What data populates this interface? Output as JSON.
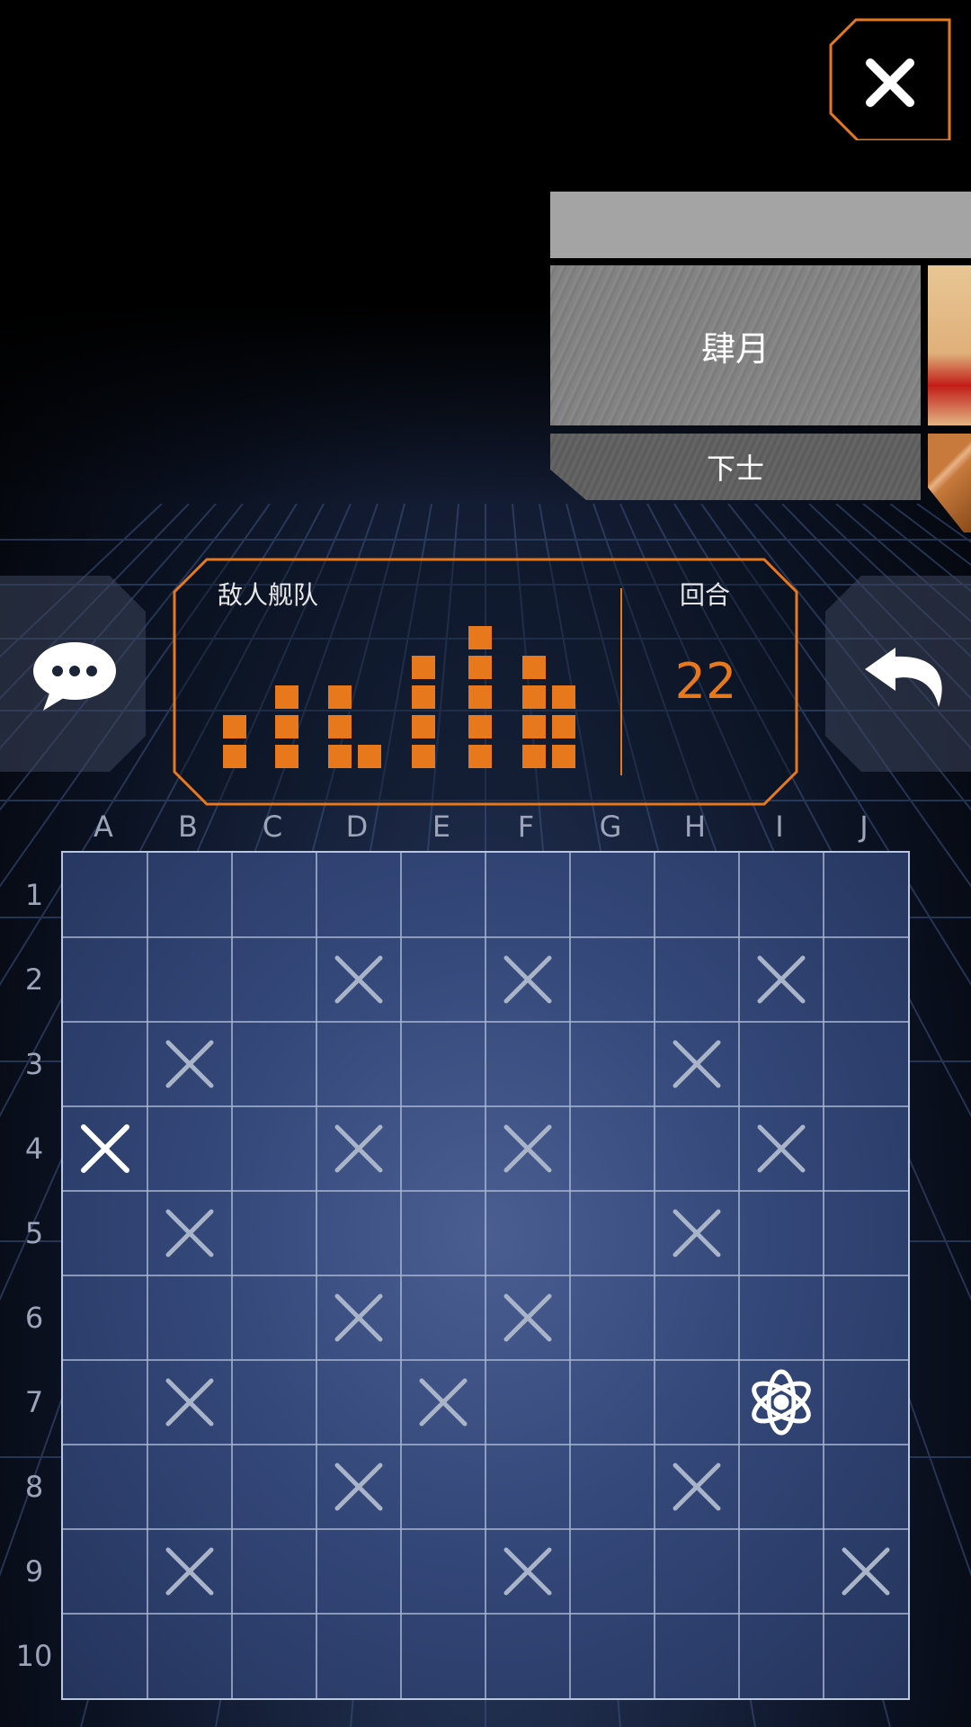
{
  "window": {
    "close_icon": "close-x-icon"
  },
  "opponent": {
    "name": "肆月",
    "rank": "下士"
  },
  "fleet_panel": {
    "title": "敌人舰队",
    "round_label": "回合",
    "round_value": "22",
    "accent_color": "#e8781c",
    "ships": [
      {
        "columns": [
          2
        ]
      },
      {
        "columns": [
          3
        ]
      },
      {
        "columns": [
          3,
          1
        ]
      },
      {
        "columns": [
          4
        ]
      },
      {
        "columns": [
          5
        ]
      },
      {
        "columns": [
          4,
          3
        ]
      }
    ]
  },
  "actions": {
    "chat_icon": "chat-bubble-icon",
    "undo_icon": "undo-arrow-icon"
  },
  "board": {
    "columns": [
      "A",
      "B",
      "C",
      "D",
      "E",
      "F",
      "G",
      "H",
      "I",
      "J"
    ],
    "rows": [
      "1",
      "2",
      "3",
      "4",
      "5",
      "6",
      "7",
      "8",
      "9",
      "10"
    ],
    "misses": [
      [
        3,
        1
      ],
      [
        5,
        1
      ],
      [
        8,
        1
      ],
      [
        1,
        2
      ],
      [
        7,
        2
      ],
      [
        3,
        3
      ],
      [
        5,
        3
      ],
      [
        8,
        3
      ],
      [
        1,
        4
      ],
      [
        7,
        4
      ],
      [
        3,
        5
      ],
      [
        5,
        5
      ],
      [
        1,
        6
      ],
      [
        4,
        6
      ],
      [
        3,
        7
      ],
      [
        7,
        7
      ],
      [
        1,
        8
      ],
      [
        5,
        8
      ],
      [
        9,
        8
      ]
    ],
    "selected": [
      0,
      3
    ],
    "special": {
      "col": 8,
      "row": 6,
      "icon": "atom-icon"
    }
  }
}
